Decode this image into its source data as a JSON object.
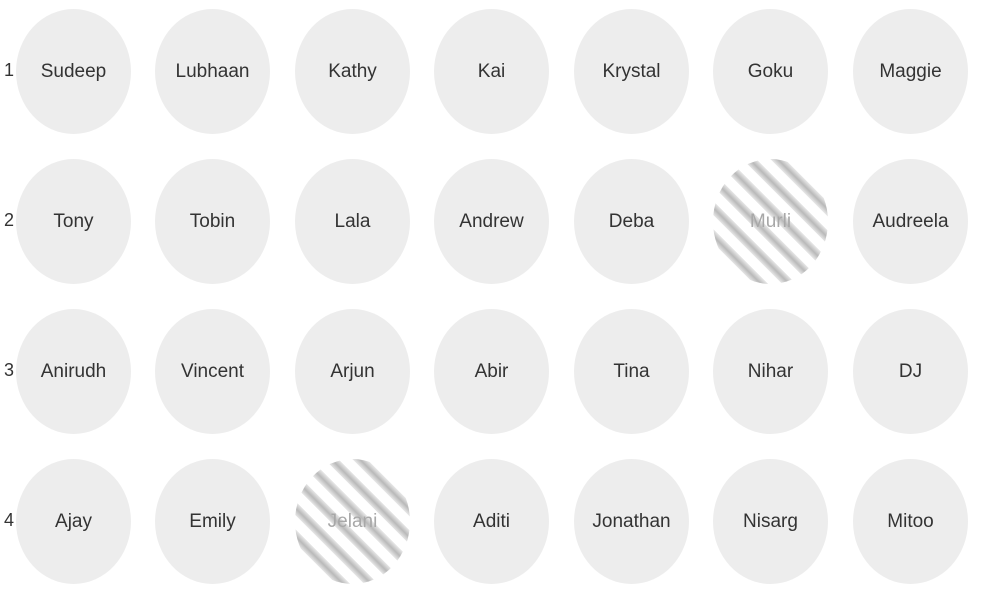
{
  "rows": [
    {
      "number": "1",
      "seats": [
        {
          "name": "Sudeep",
          "reserved": false
        },
        {
          "name": "Lubhaan",
          "reserved": false
        },
        {
          "name": "Kathy",
          "reserved": false
        },
        {
          "name": "Kai",
          "reserved": false
        },
        {
          "name": "Krystal",
          "reserved": false
        },
        {
          "name": "Goku",
          "reserved": false
        },
        {
          "name": "Maggie",
          "reserved": false
        }
      ]
    },
    {
      "number": "2",
      "seats": [
        {
          "name": "Tony",
          "reserved": false
        },
        {
          "name": "Tobin",
          "reserved": false
        },
        {
          "name": "Lala",
          "reserved": false
        },
        {
          "name": "Andrew",
          "reserved": false
        },
        {
          "name": "Deba",
          "reserved": false
        },
        {
          "name": "Murli",
          "reserved": true
        },
        {
          "name": "Audreela",
          "reserved": false
        }
      ]
    },
    {
      "number": "3",
      "seats": [
        {
          "name": "Anirudh",
          "reserved": false
        },
        {
          "name": "Vincent",
          "reserved": false
        },
        {
          "name": "Arjun",
          "reserved": false
        },
        {
          "name": "Abir",
          "reserved": false
        },
        {
          "name": "Tina",
          "reserved": false
        },
        {
          "name": "Nihar",
          "reserved": false
        },
        {
          "name": "DJ",
          "reserved": false
        }
      ]
    },
    {
      "number": "4",
      "seats": [
        {
          "name": "Ajay",
          "reserved": false
        },
        {
          "name": "Emily",
          "reserved": false
        },
        {
          "name": "Jelani",
          "reserved": true
        },
        {
          "name": "Aditi",
          "reserved": false
        },
        {
          "name": "Jonathan",
          "reserved": false
        },
        {
          "name": "Nisarg",
          "reserved": false
        },
        {
          "name": "Mitoo",
          "reserved": false
        }
      ]
    }
  ]
}
